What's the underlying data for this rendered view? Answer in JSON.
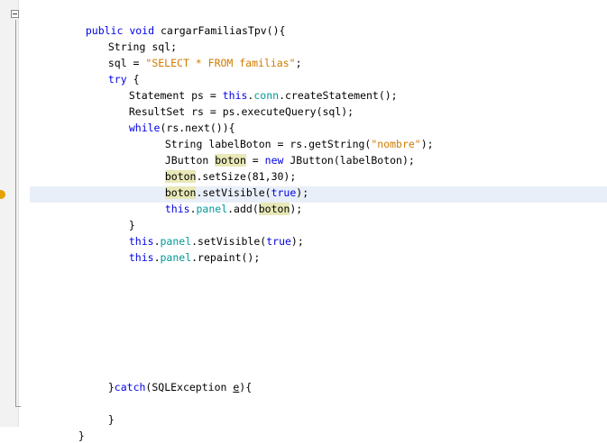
{
  "editor": {
    "method_signature": {
      "modifiers": "public void",
      "name": "cargarFamiliasTpv",
      "params": "(){"
    },
    "lines": {
      "l2": {
        "type": "String",
        "rest": "sql;"
      },
      "l3": {
        "lhs": "sql = ",
        "str": "\"SELECT * FROM familias\"",
        "end": ";"
      },
      "l4": {
        "kw": "try",
        "rest": " {"
      },
      "l5": {
        "pre": "Statement ps = ",
        "kw": "this",
        "dot": ".",
        "field": "conn",
        "rest": ".createStatement();"
      },
      "l6": {
        "text": "ResultSet rs = ps.executeQuery(sql);"
      },
      "l7": {
        "kw": "while",
        "rest": "(rs.next()){"
      },
      "l8": {
        "pre": "String labelBoton = rs.getString(",
        "str": "\"nombre\"",
        "end": ");"
      },
      "l9": {
        "pre": "JButton ",
        "var": "boton",
        "mid": " = ",
        "kw": "new",
        "rest": " JButton(labelBoton);"
      },
      "l10": {
        "var": "boton",
        "rest": ".setSize(81,30);"
      },
      "l11": {
        "var": "boton",
        "rest": ".setVisible(",
        "kw": "true",
        "end": ");"
      },
      "l12": {
        "kw": "this",
        "dot": ".",
        "field": "panel",
        "mid": ".add(",
        "var": "boton",
        "end": ");"
      },
      "l13": {
        "text": "}"
      },
      "l14": {
        "kw": "this",
        "dot": ".",
        "field": "panel",
        "mid": ".setVisible(",
        "kw2": "true",
        "end": ");"
      },
      "l15": {
        "kw": "this",
        "dot": ".",
        "field": "panel",
        "rest": ".repaint();"
      },
      "l16": {
        "pre": "}",
        "kw": "catch",
        "mid": "(SQLException ",
        "var": "e",
        "end": "){"
      },
      "l17": {
        "text": "}"
      },
      "l18": {
        "text": "}"
      }
    }
  },
  "colors": {
    "keyword": "#0000e6",
    "string": "#ce7b00",
    "field": "#009999",
    "occurrence_highlight": "#e8e8b8",
    "current_line": "#e9eff8",
    "gutter_marker": "#e6a100"
  },
  "icons": {
    "fold": "fold-collapse-icon",
    "marker": "warning-marker-icon"
  }
}
